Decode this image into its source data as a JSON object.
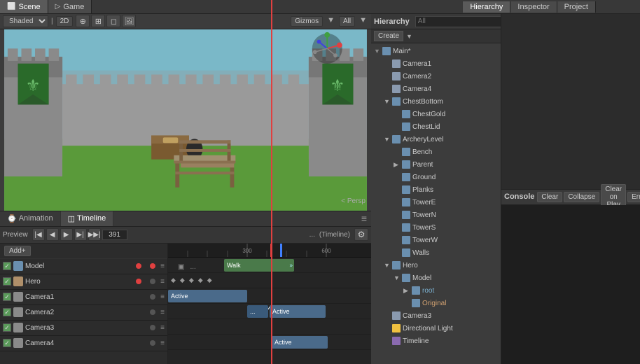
{
  "tabs": {
    "scene": "Scene",
    "game": "Game"
  },
  "viewport": {
    "shaded": "Shaded",
    "mode": "2D",
    "gizmos": "Gizmos",
    "all": "All",
    "persp": "< Persp"
  },
  "hierarchy": {
    "title": "Hierarchy",
    "search_placeholder": "All",
    "create_label": "Create",
    "items": [
      {
        "label": "Main*",
        "level": 0,
        "type": "gameobj",
        "expanded": true,
        "arrow": "▼"
      },
      {
        "label": "Camera1",
        "level": 1,
        "type": "camera",
        "arrow": ""
      },
      {
        "label": "Camera2",
        "level": 1,
        "type": "camera",
        "arrow": ""
      },
      {
        "label": "Camera3",
        "level": 1,
        "type": "camera",
        "arrow": ""
      },
      {
        "label": "Camera4",
        "level": 1,
        "type": "camera",
        "arrow": ""
      },
      {
        "label": "ChestBottom",
        "level": 1,
        "type": "gameobj",
        "expanded": true,
        "arrow": "▼"
      },
      {
        "label": "ChestGold",
        "level": 2,
        "type": "gameobj",
        "arrow": ""
      },
      {
        "label": "ChestLid",
        "level": 2,
        "type": "gameobj",
        "arrow": ""
      },
      {
        "label": "ArcheryLevel",
        "level": 1,
        "type": "gameobj",
        "expanded": true,
        "arrow": "▼"
      },
      {
        "label": "Bench",
        "level": 2,
        "type": "gameobj",
        "arrow": ""
      },
      {
        "label": "Parent",
        "level": 2,
        "type": "gameobj",
        "expanded": true,
        "arrow": "▶"
      },
      {
        "label": "Ground",
        "level": 2,
        "type": "gameobj",
        "arrow": ""
      },
      {
        "label": "Planks",
        "level": 2,
        "type": "gameobj",
        "arrow": ""
      },
      {
        "label": "TowerE",
        "level": 2,
        "type": "gameobj",
        "arrow": ""
      },
      {
        "label": "TowerN",
        "level": 2,
        "type": "gameobj",
        "arrow": ""
      },
      {
        "label": "TowerS",
        "level": 2,
        "type": "gameobj",
        "arrow": ""
      },
      {
        "label": "TowerW",
        "level": 2,
        "type": "gameobj",
        "arrow": ""
      },
      {
        "label": "Walls",
        "level": 2,
        "type": "gameobj",
        "arrow": ""
      },
      {
        "label": "Hero",
        "level": 1,
        "type": "gameobj",
        "expanded": true,
        "arrow": "▼"
      },
      {
        "label": "Model",
        "level": 2,
        "type": "gameobj",
        "expanded": true,
        "arrow": "▼"
      },
      {
        "label": "root",
        "level": 3,
        "type": "gameobj",
        "expanded": true,
        "arrow": "▶"
      },
      {
        "label": "Original",
        "level": 3,
        "type": "gameobj",
        "arrow": ""
      },
      {
        "label": "Camera3",
        "level": 1,
        "type": "camera",
        "arrow": ""
      },
      {
        "label": "Directional Light",
        "level": 1,
        "type": "light",
        "arrow": ""
      },
      {
        "label": "Timeline",
        "level": 1,
        "type": "timeline",
        "arrow": ""
      }
    ]
  },
  "inspector": {
    "title": "Inspector"
  },
  "project": {
    "title": "Project"
  },
  "animation": {
    "tab1": "Animation",
    "tab2": "Timeline",
    "preview": "Preview",
    "frame": "391",
    "timeline_label": "(Timeline)"
  },
  "tracks": [
    {
      "name": "Model",
      "type": "model",
      "enabled": true
    },
    {
      "name": "Hero",
      "type": "hero",
      "enabled": true
    },
    {
      "name": "Camera1",
      "type": "camera",
      "enabled": true
    },
    {
      "name": "Camera2",
      "type": "camera",
      "enabled": true
    },
    {
      "name": "Camera3",
      "type": "camera",
      "enabled": true
    },
    {
      "name": "Camera4",
      "type": "camera",
      "enabled": true
    }
  ],
  "timeline": {
    "marker1": "300",
    "marker2": "600"
  },
  "add_button": "Add+",
  "console": {
    "title": "Console",
    "clear": "Clear",
    "collapse": "Collapse",
    "clear_on_play": "Clear on Play",
    "error_pause": "Err"
  },
  "clips": {
    "walk": "Walk",
    "active": "Active",
    "dots": "..."
  }
}
